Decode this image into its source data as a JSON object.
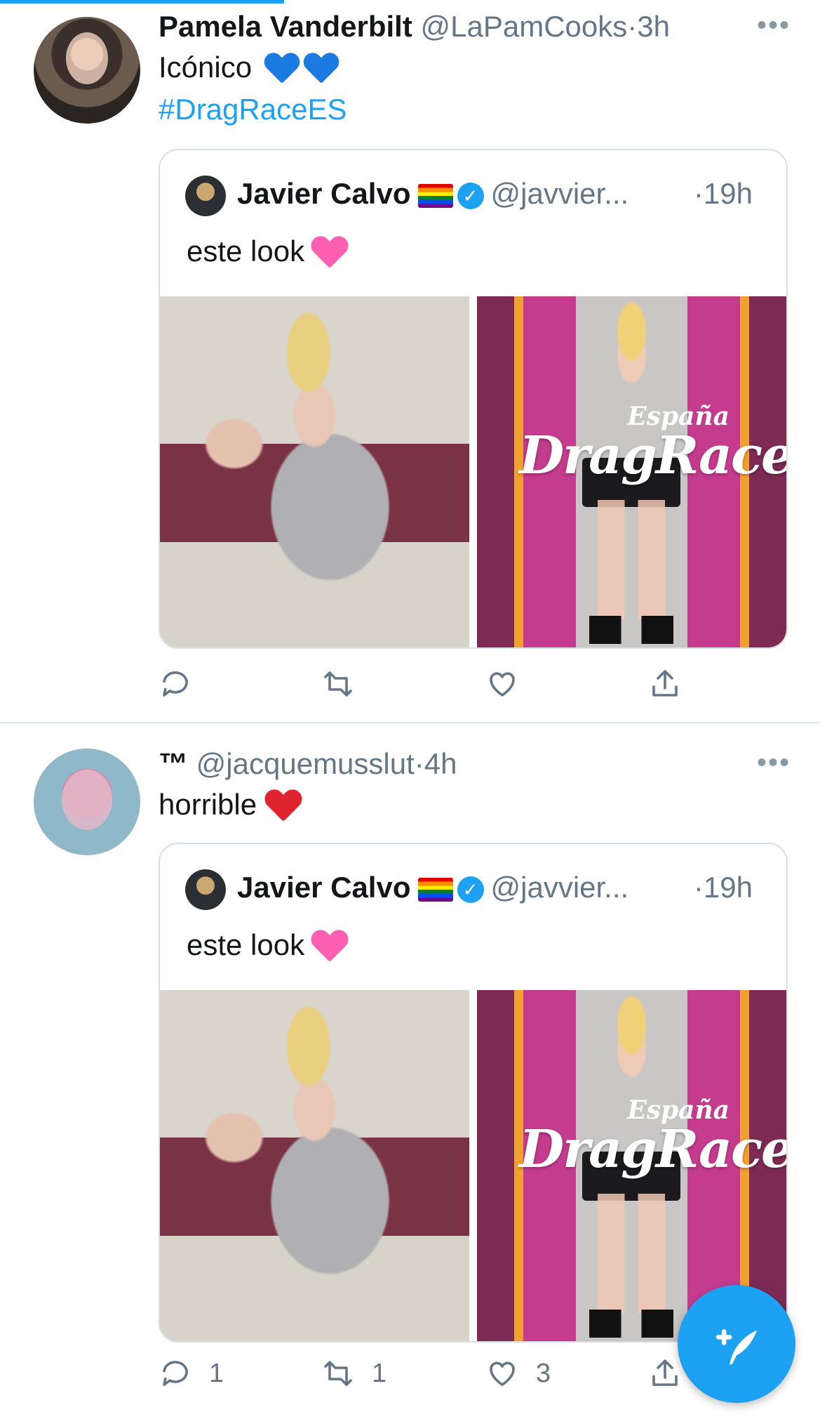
{
  "tweets": [
    {
      "author_name": "Pamela Vanderbilt",
      "author_handle": "@LaPamCooks",
      "time": "3h",
      "text": "Icónico",
      "hashtag": "#DragRaceES",
      "emoji": [
        "blue-heart",
        "blue-heart"
      ],
      "reply_count": "",
      "retweet_count": "",
      "like_count": ""
    },
    {
      "author_name": "™",
      "author_handle": "@jacquemusslut",
      "time": "4h",
      "text": "horrible",
      "emoji": [
        "red-heart"
      ],
      "reply_count": "1",
      "retweet_count": "1",
      "like_count": "3"
    }
  ],
  "quoted_tweet": {
    "author_name": "Javier Calvo",
    "author_handle": "@javvier...",
    "time": "19h",
    "text": "este look",
    "emoji": "two-hearts",
    "logo_line1": "España",
    "logo_line2": "DragRace",
    "photos": [
      "cafeteria-selfie",
      "drag-race-promo"
    ]
  },
  "separator": "·",
  "more_label": "•••",
  "icons": [
    "reply-icon",
    "retweet-icon",
    "like-icon",
    "share-icon",
    "compose-tweet-icon",
    "verified-icon",
    "rainbow-flag-icon"
  ],
  "colors": {
    "accent": "#1da1f2",
    "text": "#14171a",
    "muted": "#657786",
    "border": "#d8dfe4"
  }
}
